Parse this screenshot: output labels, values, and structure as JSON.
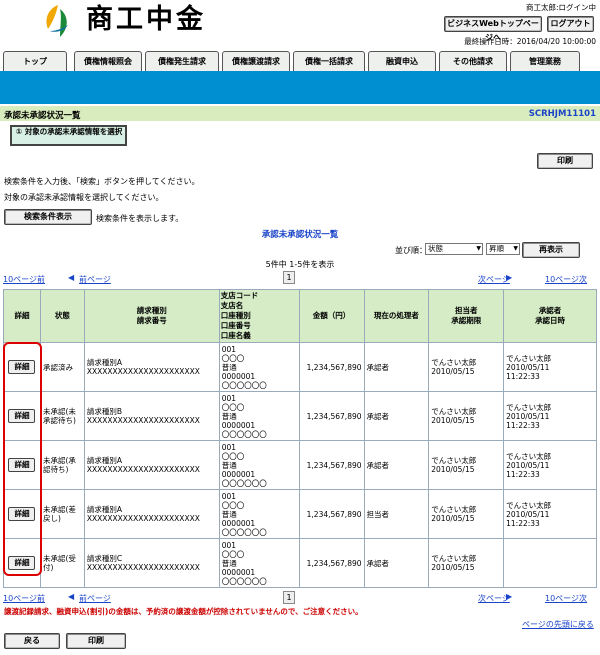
{
  "header": {
    "logo_text": "商工中金",
    "user_status": "商工太郎:ログイン中",
    "webtop_button": "ビジネスWebトップページへ",
    "logout_button": "ログアウト",
    "last_operation": "最終操作日時：2016/04/20 10:00:00"
  },
  "nav": {
    "tabs": [
      "トップ",
      "債権情報照会",
      "債権発生請求",
      "債権譲渡請求",
      "債権一括請求",
      "融資申込",
      "その他請求",
      "管理業務"
    ]
  },
  "page": {
    "title": "承認未承認状況一覧",
    "screen_id": "SCRHJM11101",
    "step_label": "① 対象の承認未承認情報を選択",
    "print_button": "印刷",
    "instructions": [
      "検索条件を入力後、「検索」ボタンを押してください。",
      "対象の承認未承認情報を選択してください。"
    ],
    "search_toggle_button": "検索条件表示",
    "search_toggle_text": "検索条件を表示します。",
    "list_title": "承認未承認状況一覧"
  },
  "sort": {
    "label": "並び順：",
    "key": "状態",
    "order": "昇順",
    "button": "再表示"
  },
  "paging": {
    "count_text": "5件中 1-5件を表示",
    "prev10": "10ページ前",
    "prev": "前ページ",
    "page": "1",
    "next": "次ページ",
    "next10": "10ページ次"
  },
  "table": {
    "headers": [
      "詳細",
      "状態",
      "請求種別\n請求番号",
      "支店コード\n支店名\n口座種別\n口座番号\n口座名義",
      "金額（円）",
      "現在の処理者",
      "担当者\n承認期限",
      "承認者\n承認日時"
    ],
    "rows": [
      {
        "detail": "詳細",
        "status": "承認済み",
        "type": "請求種別A",
        "number": "XXXXXXXXXXXXXXXXXXXXXX",
        "branch_code": "001",
        "branch": "〇〇〇",
        "acct_type": "普通",
        "acct_no": "0000001",
        "acct_name": "〇〇〇〇〇〇",
        "amount": "1,234,567,890",
        "processor": "承認者",
        "staff": "でんさい太郎",
        "deadline": "2010/05/15",
        "approver": "でんさい太郎",
        "approved_date": "2010/05/11",
        "approved_time": "11:22:33"
      },
      {
        "detail": "詳細",
        "status": "未承認(未承認待ち)",
        "type": "請求種別B",
        "number": "XXXXXXXXXXXXXXXXXXXXXX",
        "branch_code": "001",
        "branch": "〇〇〇",
        "acct_type": "普通",
        "acct_no": "0000001",
        "acct_name": "〇〇〇〇〇〇",
        "amount": "1,234,567,890",
        "processor": "承認者",
        "staff": "でんさい太郎",
        "deadline": "2010/05/15",
        "approver": "でんさい太郎",
        "approved_date": "2010/05/11",
        "approved_time": "11:22:33"
      },
      {
        "detail": "詳細",
        "status": "未承認(承認待ち)",
        "type": "請求種別A",
        "number": "XXXXXXXXXXXXXXXXXXXXXX",
        "branch_code": "001",
        "branch": "〇〇〇",
        "acct_type": "普通",
        "acct_no": "0000001",
        "acct_name": "〇〇〇〇〇〇",
        "amount": "1,234,567,890",
        "processor": "承認者",
        "staff": "でんさい太郎",
        "deadline": "2010/05/15",
        "approver": "でんさい太郎",
        "approved_date": "2010/05/11",
        "approved_time": "11:22:33"
      },
      {
        "detail": "詳細",
        "status": "未承認(差戻し)",
        "type": "請求種別A",
        "number": "XXXXXXXXXXXXXXXXXXXXXX",
        "branch_code": "001",
        "branch": "〇〇〇",
        "acct_type": "普通",
        "acct_no": "0000001",
        "acct_name": "〇〇〇〇〇〇",
        "amount": "1,234,567,890",
        "processor": "担当者",
        "staff": "でんさい太郎",
        "deadline": "2010/05/15",
        "approver": "でんさい太郎",
        "approved_date": "2010/05/11",
        "approved_time": "11:22:33"
      },
      {
        "detail": "詳細",
        "status": "未承認(受付)",
        "type": "請求種別C",
        "number": "XXXXXXXXXXXXXXXXXXXXXX",
        "branch_code": "001",
        "branch": "〇〇〇",
        "acct_type": "普通",
        "acct_no": "0000001",
        "acct_name": "〇〇〇〇〇〇",
        "amount": "1,234,567,890",
        "processor": "承認者",
        "staff": "でんさい太郎",
        "deadline": "2010/05/15",
        "approver": "",
        "approved_date": "",
        "approved_time": ""
      }
    ]
  },
  "footer": {
    "notice": "譲渡記録請求、融資申込(割引)の金額は、予約済の譲渡金額が控除されていませんので、ご注意ください。",
    "back_to_top": "ページの先頭に戻る",
    "back_button": "戻る",
    "print_button": "印刷"
  },
  "colors": {
    "accent_bar": "#008fd0",
    "title_bar": "#d8ecbd",
    "highlight": "#dd0000",
    "link": "#1a44c8"
  }
}
